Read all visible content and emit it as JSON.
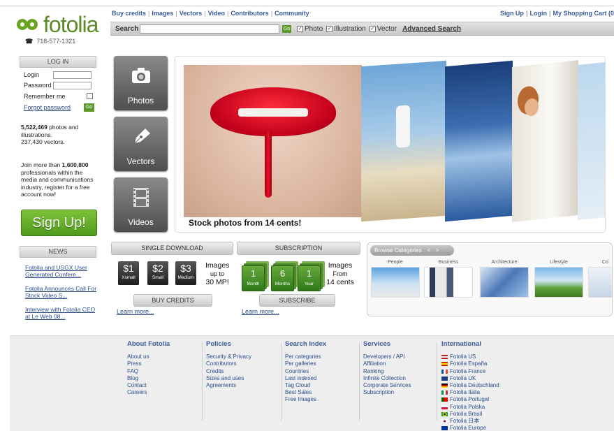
{
  "header": {
    "logo_text": "fotolia",
    "phone": "718-577-1321",
    "nav": [
      "Buy credits",
      "Images",
      "Vectors",
      "Video",
      "Contributors",
      "Community"
    ],
    "top_links": [
      "Sign Up",
      "Login",
      "My Shopping Cart (0"
    ]
  },
  "search": {
    "label": "Search",
    "value": "",
    "go_label": "Go",
    "options": [
      {
        "label": "Photo",
        "checked": true
      },
      {
        "label": "Illustration",
        "checked": true
      },
      {
        "label": "Vector",
        "checked": true
      }
    ],
    "advanced_label": "Advanced Search"
  },
  "login": {
    "title": "LOG IN",
    "login_label": "Login",
    "password_label": "Password",
    "remember_label": "Remember me",
    "forgot_label": "Forgot password",
    "go_label": "Go"
  },
  "stats": {
    "photos_count": "5,522,469",
    "photos_text": "photos and illustrations.",
    "vectors_text": "237,430 vectors."
  },
  "join": {
    "prefix": "Join more than",
    "count": "1,600,800",
    "suffix": "professionals within the media and communications industry, register for a free account now!"
  },
  "signup_label": "Sign Up!",
  "news": {
    "title": "NEWS",
    "items": [
      "Fotolia and USGX User Generated Confere...",
      "Fotolia Announces Call For Stock Video S...",
      "Interview with Fotolia CEO at Le Web 08..."
    ]
  },
  "media_buttons": [
    "Photos",
    "Vectors",
    "Videos"
  ],
  "banner": {
    "caption": "Stock photos from 14 cents!"
  },
  "single": {
    "tab": "SINGLE DOWNLOAD",
    "prices": [
      {
        "price": "$1",
        "size": "Xsmall"
      },
      {
        "price": "$2",
        "size": "Small"
      },
      {
        "price": "$3",
        "size": "Medium"
      }
    ],
    "line1": "Images",
    "line2": "up to",
    "line3": "30 MP!",
    "button": "BUY CREDITS",
    "learn": "Learn more..."
  },
  "subscription": {
    "tab": "SUBSCRIPTION",
    "plans": [
      {
        "num": "1",
        "unit": "Month"
      },
      {
        "num": "6",
        "unit": "Months"
      },
      {
        "num": "1",
        "unit": "Year"
      }
    ],
    "line1": "Images",
    "line2": "From",
    "line3": "14 cents",
    "button": "SUBSCRIBE",
    "learn": "Learn more..."
  },
  "browse": {
    "title": "Browse Categories",
    "categories": [
      "People",
      "Business",
      "Architecture",
      "Lifestyle",
      "Co"
    ]
  },
  "footer": {
    "columns": [
      {
        "title": "About Fotolia",
        "items": [
          "About us",
          "Press",
          "FAQ",
          "Blog",
          "Contact",
          "Careers"
        ]
      },
      {
        "title": "Policies",
        "items": [
          "Security & Privacy",
          "Contributors",
          "Credits",
          "Sizes and uses",
          "Agreements"
        ]
      },
      {
        "title": "Search Index",
        "items": [
          "Per categories",
          "Per galleries",
          "Countries",
          "Last indexed",
          "Tag Cloud",
          "Best Sales",
          "Free Images"
        ]
      },
      {
        "title": "Services",
        "items": [
          "Developers / API",
          "Affiliation",
          "Ranking",
          "Infinite Collection",
          "Corporate Services",
          "Subscription"
        ]
      },
      {
        "title": "International",
        "items": [
          "Fotolia US",
          "Fotolia España",
          "Fotolia France",
          "Fotolia UK",
          "Fotolia Deutschland",
          "Fotolia Italia",
          "Fotolia Portugal",
          "Fotolia Polska",
          "Fotolia Brasil",
          "Fotolia 日本",
          "Fotolia Europe"
        ]
      }
    ]
  },
  "colors": {
    "brand_green": "#5d8a26",
    "link_blue": "#2a4d8f",
    "signup_green": "#4e9a1c"
  }
}
